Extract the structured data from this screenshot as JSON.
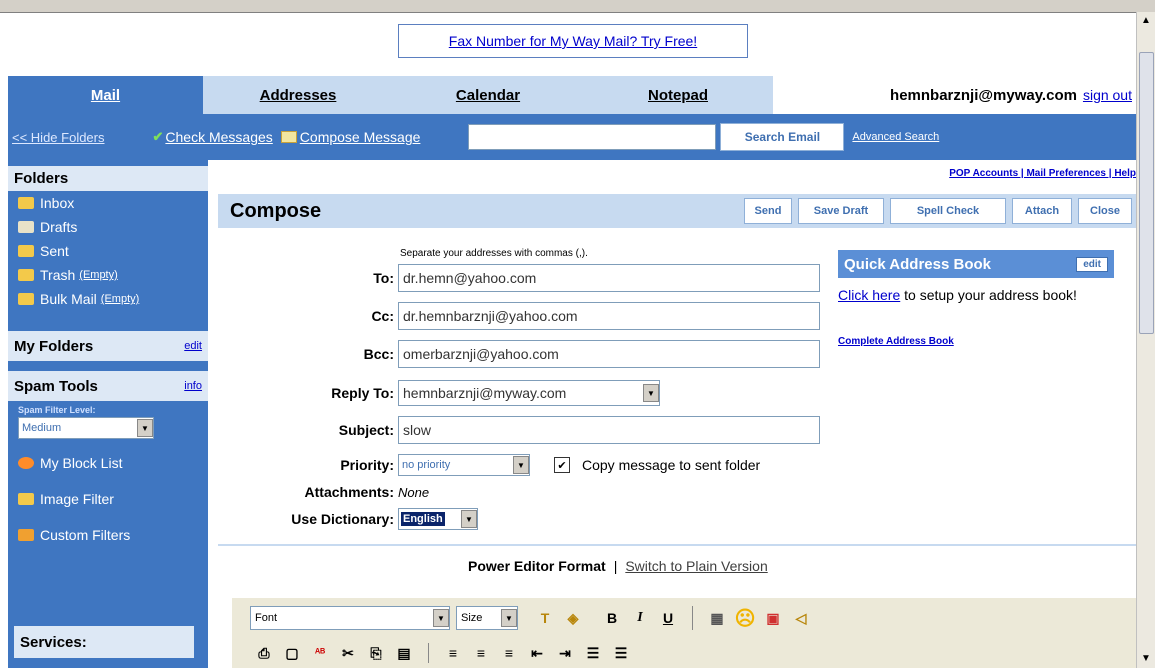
{
  "ad": {
    "text": "Fax Number for My Way Mail? Try Free!"
  },
  "nav": {
    "tabs": [
      "Mail",
      "Addresses",
      "Calendar",
      "Notepad"
    ],
    "user_email": "hemnbarznji@myway.com",
    "sign_out": "sign out"
  },
  "toolbar": {
    "hide_folders": "<< Hide Folders",
    "check_messages": "Check Messages",
    "compose_message": "Compose Message",
    "search_placeholder": "",
    "search_button": "Search Email",
    "advanced_search": "Advanced Search"
  },
  "sidebar": {
    "folders_title": "Folders",
    "folders": [
      {
        "label": "Inbox",
        "extra": ""
      },
      {
        "label": "Drafts",
        "extra": ""
      },
      {
        "label": "Sent",
        "extra": ""
      },
      {
        "label": "Trash",
        "extra": "(Empty)"
      },
      {
        "label": "Bulk Mail",
        "extra": "(Empty)"
      }
    ],
    "my_folders_title": "My Folders",
    "my_folders_edit": "edit",
    "spam_tools_title": "Spam Tools",
    "spam_tools_info": "info",
    "spam_filter_label": "Spam Filter Level:",
    "spam_filter_value": "Medium",
    "spam_items": [
      "My Block List",
      "Image Filter",
      "Custom Filters"
    ],
    "services_title": "Services:"
  },
  "main": {
    "top_links": "POP Accounts | Mail Preferences | Help",
    "compose_title": "Compose",
    "buttons": [
      "Send",
      "Save Draft",
      "Spell Check",
      "Attach",
      "Close"
    ],
    "separator_hint": "Separate your addresses with commas (,).",
    "to_label": "To:",
    "to_value": "dr.hemn@yahoo.com",
    "cc_label": "Cc:",
    "cc_value": "dr.hemnbarznji@yahoo.com",
    "bcc_label": "Bcc:",
    "bcc_value": "omerbarznji@yahoo.com",
    "reply_to_label": "Reply To:",
    "reply_to_value": "hemnbarznji@myway.com",
    "subject_label": "Subject:",
    "subject_value": "slow",
    "priority_label": "Priority:",
    "priority_value": "no priority",
    "copy_to_sent": "Copy message to sent folder",
    "attachments_label": "Attachments:",
    "attachments_value": "None",
    "dictionary_label": "Use Dictionary:",
    "dictionary_value": "English",
    "editor_format": "Power Editor Format",
    "switch_plain": "Switch to Plain Version",
    "font_select": "Font",
    "size_select": "Size"
  },
  "qab": {
    "title": "Quick Address Book",
    "edit": "edit",
    "setup_link": "Click here",
    "setup_text": "to setup your address book!",
    "complete_link": "Complete Address Book"
  }
}
